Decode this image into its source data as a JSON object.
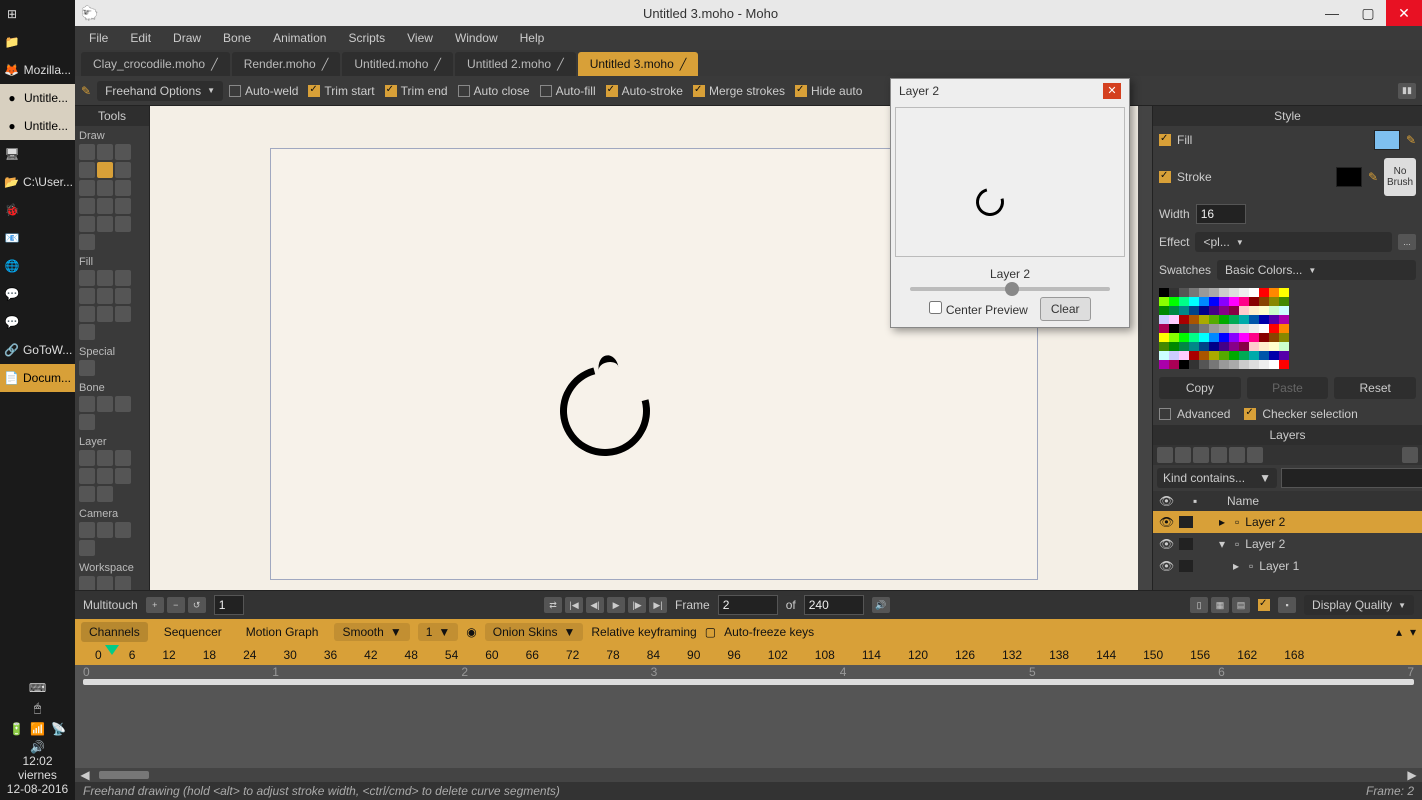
{
  "taskbar": {
    "items": [
      {
        "icon": "⊞",
        "label": ""
      },
      {
        "icon": "📁",
        "label": ""
      },
      {
        "icon": "🦊",
        "label": "Mozilla..."
      },
      {
        "icon": "●",
        "label": "Untitle...",
        "light": true
      },
      {
        "icon": "●",
        "label": "Untitle...",
        "light": true
      },
      {
        "icon": "🖥",
        "label": ""
      },
      {
        "icon": "📂",
        "label": "C:\\User..."
      },
      {
        "icon": "🐞",
        "label": ""
      },
      {
        "icon": "📧",
        "label": ""
      },
      {
        "icon": "🌐",
        "label": ""
      },
      {
        "icon": "💬",
        "label": ""
      },
      {
        "icon": "💬",
        "label": ""
      },
      {
        "icon": "🔗",
        "label": "GoToW..."
      },
      {
        "icon": "📄",
        "label": "Docum...",
        "active": true
      }
    ],
    "clock": "12:02",
    "day": "viernes",
    "date": "12-08-2016"
  },
  "titlebar": {
    "title": "Untitled 3.moho - Moho"
  },
  "menu": [
    "File",
    "Edit",
    "Draw",
    "Bone",
    "Animation",
    "Scripts",
    "View",
    "Window",
    "Help"
  ],
  "filetabs": [
    {
      "label": "Clay_crocodile.moho"
    },
    {
      "label": "Render.moho"
    },
    {
      "label": "Untitled.moho"
    },
    {
      "label": "Untitled 2.moho"
    },
    {
      "label": "Untitled 3.moho",
      "active": true
    }
  ],
  "toolbar": {
    "freehand": "Freehand Options",
    "opts": [
      {
        "label": "Auto-weld",
        "on": false
      },
      {
        "label": "Trim start",
        "on": true
      },
      {
        "label": "Trim end",
        "on": true
      },
      {
        "label": "Auto close",
        "on": false
      },
      {
        "label": "Auto-fill",
        "on": false
      },
      {
        "label": "Auto-stroke",
        "on": true
      },
      {
        "label": "Merge strokes",
        "on": true
      },
      {
        "label": "Hide auto",
        "on": true
      }
    ]
  },
  "tools": {
    "title": "Tools",
    "sections": [
      "Draw",
      "Fill",
      "Special",
      "Bone",
      "Layer",
      "Camera",
      "Workspace"
    ]
  },
  "preview": {
    "title": "Layer 2",
    "layer_label": "Layer 2",
    "center_label": "Center Preview",
    "clear_label": "Clear"
  },
  "style": {
    "title": "Style",
    "fill_label": "Fill",
    "fill_color": "#7ec0f0",
    "stroke_label": "Stroke",
    "stroke_color": "#000000",
    "width_label": "Width",
    "width_value": "16",
    "nobrush": "No Brush",
    "effect_label": "Effect",
    "effect_value": "<pl...",
    "swatches_label": "Swatches",
    "swatches_set": "Basic Colors...",
    "copy": "Copy",
    "paste": "Paste",
    "reset": "Reset",
    "advanced": "Advanced",
    "checker": "Checker selection"
  },
  "layers": {
    "title": "Layers",
    "filter": "Kind contains...",
    "cols": [
      "",
      "",
      "Name"
    ],
    "items": [
      {
        "name": "Layer 2",
        "sel": true,
        "indent": 1
      },
      {
        "name": "Layer 2",
        "sel": false,
        "indent": 1,
        "expand": true
      },
      {
        "name": "Layer 1",
        "sel": false,
        "indent": 2
      }
    ]
  },
  "timeline": {
    "multitouch": "Multitouch",
    "mt_value": "1",
    "frame_label": "Frame",
    "frame_value": "2",
    "of_label": "of",
    "total_value": "240",
    "display_quality": "Display Quality",
    "tabs": [
      "Channels",
      "Sequencer",
      "Motion Graph"
    ],
    "smooth": "Smooth",
    "smooth_val": "1",
    "onion": "Onion Skins",
    "relative": "Relative keyframing",
    "autofreeze": "Auto-freeze keys",
    "ruler": [
      "0",
      "6",
      "12",
      "18",
      "24",
      "30",
      "36",
      "42",
      "48",
      "54",
      "60",
      "66",
      "72",
      "78",
      "84",
      "90",
      "96",
      "102",
      "108",
      "114",
      "120",
      "126",
      "132",
      "138",
      "144",
      "150",
      "156",
      "162",
      "168"
    ],
    "graph_ruler": [
      "0",
      "1",
      "2",
      "3",
      "4",
      "5",
      "6",
      "7"
    ]
  },
  "status": {
    "hint": "Freehand drawing (hold <alt> to adjust stroke width, <ctrl/cmd> to delete curve segments)",
    "frame": "Frame: 2"
  }
}
